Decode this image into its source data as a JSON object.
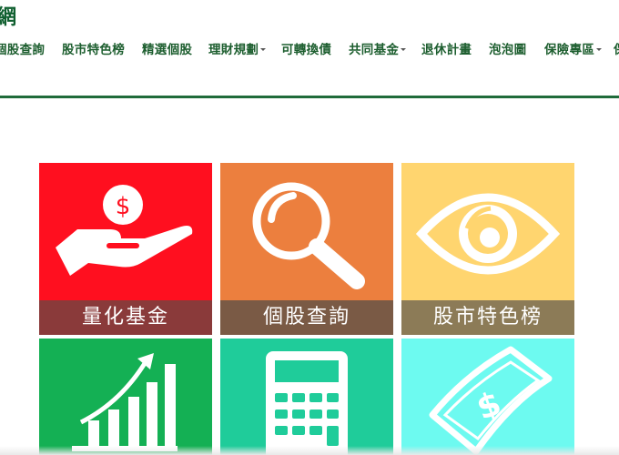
{
  "header": {
    "logo_fragment": "網"
  },
  "nav": {
    "items": [
      {
        "label": "個股查詢",
        "dropdown": false
      },
      {
        "label": "股市特色榜",
        "dropdown": false
      },
      {
        "label": "精選個股",
        "dropdown": false
      },
      {
        "label": "理財規劃",
        "dropdown": true
      },
      {
        "label": "可轉換債",
        "dropdown": false
      },
      {
        "label": "共同基金",
        "dropdown": true
      },
      {
        "label": "退休計畫",
        "dropdown": false
      },
      {
        "label": "泡泡圖",
        "dropdown": false
      },
      {
        "label": "保險專區",
        "dropdown": true
      }
    ]
  },
  "tiles": [
    {
      "label": "量化基金",
      "icon": "money-hand-icon",
      "bg": "#ff0f1f",
      "bar": "#8a3a3a"
    },
    {
      "label": "個股查詢",
      "icon": "magnifier-icon",
      "bg": "#ec7f3e",
      "bar": "#7a5a45"
    },
    {
      "label": "股市特色榜",
      "icon": "eye-icon",
      "bg": "#ffd56f",
      "bar": "#8c7b57"
    },
    {
      "label": "",
      "icon": "growth-chart-icon",
      "bg": "#14b054",
      "bar": ""
    },
    {
      "label": "",
      "icon": "calculator-icon",
      "bg": "#1fcc9a",
      "bar": ""
    },
    {
      "label": "",
      "icon": "banknote-icon",
      "bg": "#6dfaf0",
      "bar": ""
    }
  ]
}
